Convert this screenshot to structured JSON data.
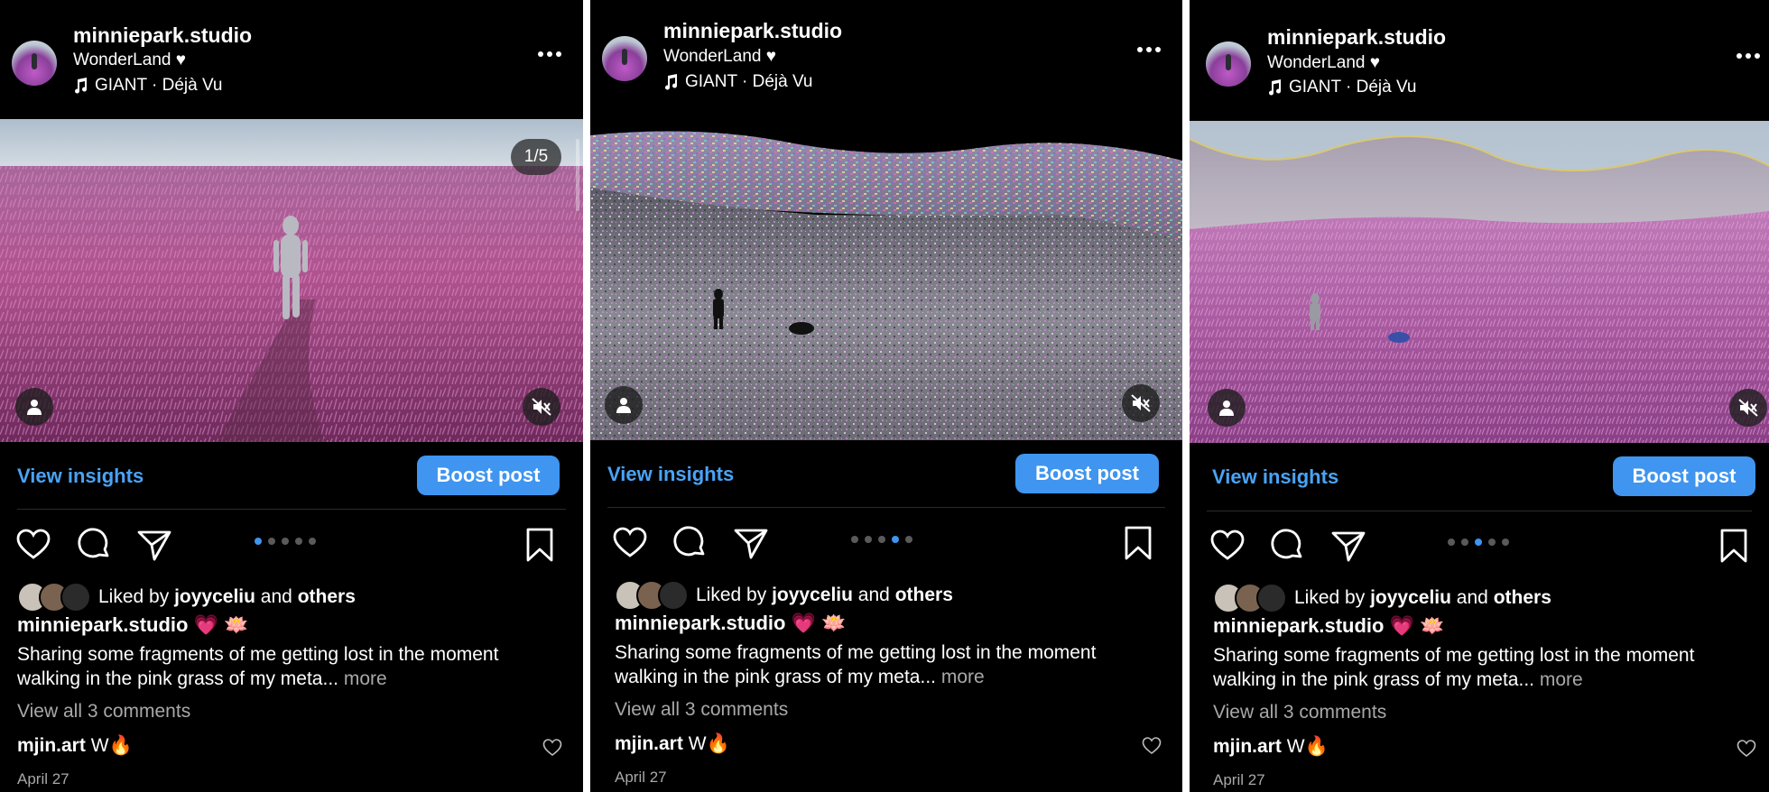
{
  "posts": [
    {
      "username": "minniepark.studio",
      "subtitle": "WonderLand ♥",
      "music": "GIANT · Déjà Vu",
      "counter": "1/5",
      "active_dot": 0,
      "dot_count": 5,
      "insights_label": "View insights",
      "boost_label": "Boost post",
      "liked_prefix": "Liked by",
      "liked_user": "joyyceliu",
      "liked_and": "and",
      "liked_others": "others",
      "caption_user": "minniepark.studio",
      "caption_emoji": "💗 🪷",
      "caption_text": "Sharing some fragments of me getting lost in the moment walking in the pink grass of my meta...",
      "caption_more": "more",
      "view_comments": "View all 3 comments",
      "comment_user": "mjin.art",
      "comment_text": "W🔥",
      "date": "April 27"
    },
    {
      "username": "minniepark.studio",
      "subtitle": "WonderLand ♥",
      "music": "GIANT · Déjà Vu",
      "active_dot": 3,
      "dot_count": 5,
      "insights_label": "View insights",
      "boost_label": "Boost post",
      "liked_prefix": "Liked by",
      "liked_user": "joyyceliu",
      "liked_and": "and",
      "liked_others": "others",
      "caption_user": "minniepark.studio",
      "caption_emoji": "💗 🪷",
      "caption_text": "Sharing some fragments of me getting lost in the moment walking in the pink grass of my meta...",
      "caption_more": "more",
      "view_comments": "View all 3 comments",
      "comment_user": "mjin.art",
      "comment_text": "W🔥",
      "date": "April 27"
    },
    {
      "username": "minniepark.studio",
      "subtitle": "WonderLand ♥",
      "music": "GIANT · Déjà Vu",
      "active_dot": 2,
      "dot_count": 5,
      "insights_label": "View insights",
      "boost_label": "Boost post",
      "liked_prefix": "Liked by",
      "liked_user": "joyyceliu",
      "liked_and": "and",
      "liked_others": "others",
      "caption_user": "minniepark.studio",
      "caption_emoji": "💗 🪷",
      "caption_text": "Sharing some fragments of me getting lost in the moment walking in the pink grass of my meta...",
      "caption_more": "more",
      "view_comments": "View all 3 comments",
      "comment_user": "mjin.art",
      "comment_text": "W🔥",
      "date": "April 27"
    }
  ],
  "colors": {
    "accent": "#3f95ef",
    "link": "#4aa3f5",
    "background": "#000000",
    "muted": "#a8a8a8"
  }
}
